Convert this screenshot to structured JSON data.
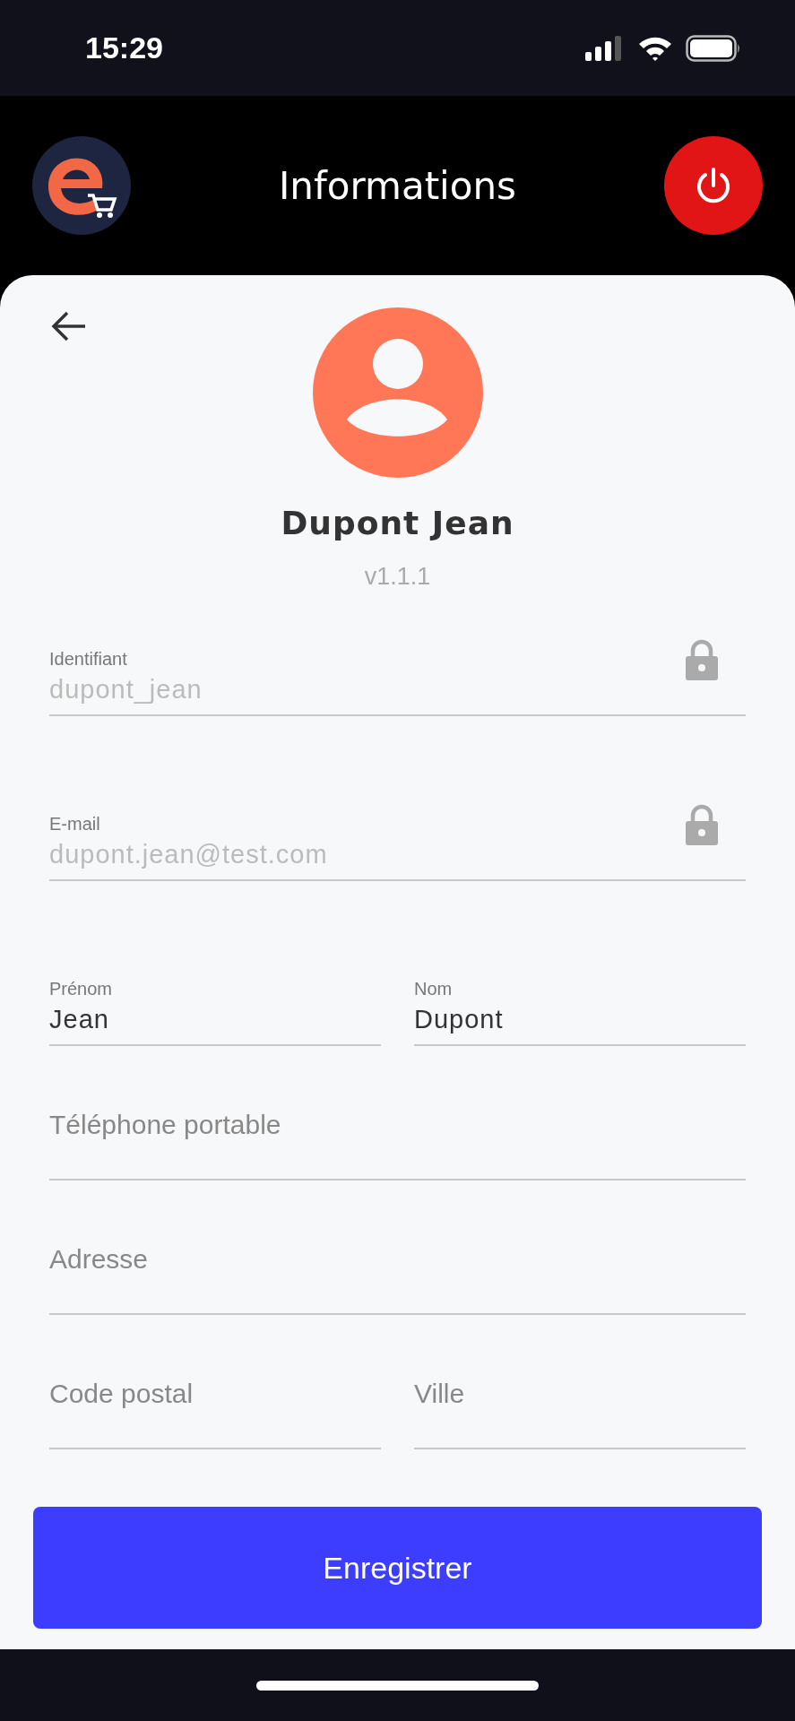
{
  "status_bar": {
    "time": "15:29"
  },
  "header": {
    "title": "Informations"
  },
  "profile": {
    "name": "Dupont Jean",
    "version": "v1.1.1"
  },
  "form_rows": [
    [
      {
        "label": "Identifiant",
        "value": "dupont_jean",
        "disabled": true
      }
    ],
    [
      {
        "label": "E-mail",
        "value": "dupont.jean@test.com",
        "disabled": true
      }
    ],
    [
      {
        "label": "Prénom",
        "value": "Jean",
        "disabled": false
      },
      {
        "label": "Nom",
        "value": "Dupont",
        "disabled": false
      }
    ],
    [
      {
        "placeholder": "Téléphone portable",
        "disabled": false
      }
    ],
    [
      {
        "placeholder": "Adresse",
        "disabled": false
      }
    ],
    [
      {
        "placeholder": "Code postal",
        "disabled": false
      },
      {
        "placeholder": "Ville",
        "disabled": false
      }
    ]
  ],
  "buttons": [
    "Enregistrer"
  ]
}
